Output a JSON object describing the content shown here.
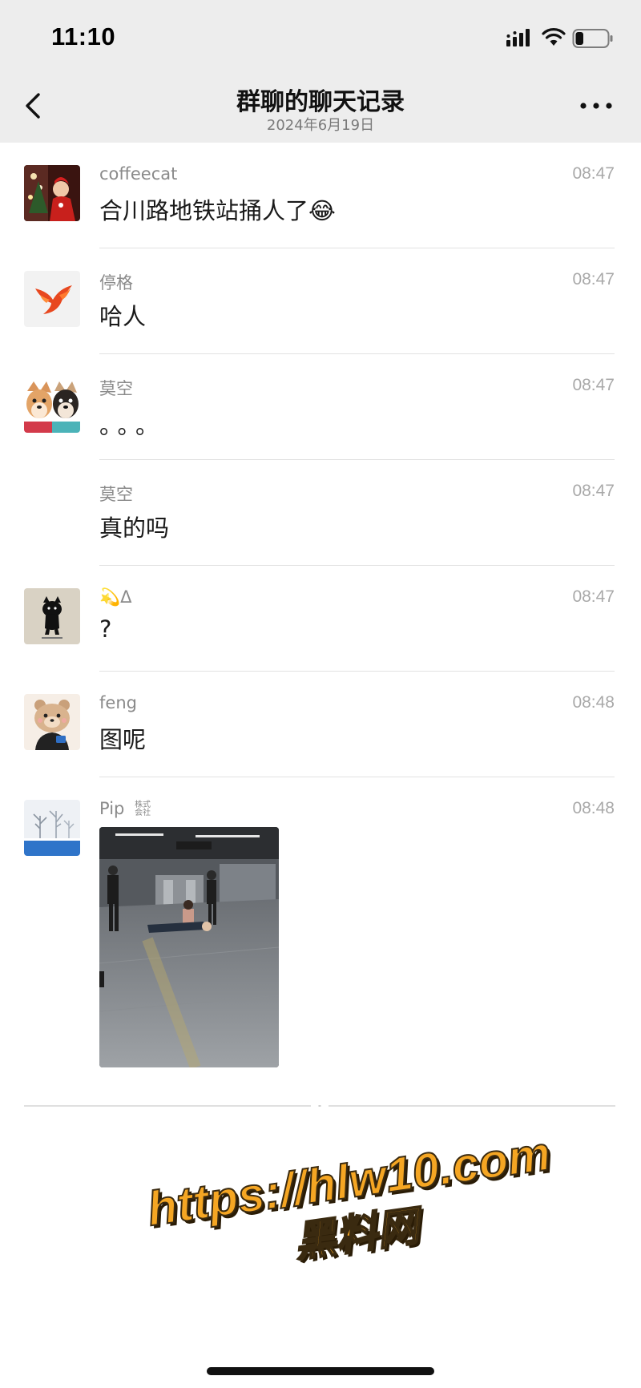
{
  "status_bar": {
    "time": "11:10",
    "signal_icon": "cellular-signal-icon",
    "wifi_icon": "wifi-icon",
    "battery_icon": "battery-icon",
    "battery_level": 0.25
  },
  "nav": {
    "back_icon": "chevron-left-icon",
    "title": "群聊的聊天记录",
    "subtitle": "2024年6月19日",
    "more_icon": "more-dots-icon"
  },
  "messages": [
    {
      "sender": "coffeecat",
      "time": "08:47",
      "text": "合川路地铁站捅人了😂",
      "avatar": "christmas-photo-avatar"
    },
    {
      "sender": "停格",
      "time": "08:47",
      "text": "哈人",
      "avatar": "red-phoenix-avatar"
    },
    {
      "sender": "莫空",
      "time": "08:47",
      "text": "。。。",
      "avatar": "shiba-dogs-avatar"
    },
    {
      "sender": "莫空",
      "time": "08:47",
      "text": "真的吗",
      "avatar": ""
    },
    {
      "sender": "💫ᐃ",
      "time": "08:47",
      "text": "?",
      "avatar": "black-cat-avatar"
    },
    {
      "sender": "feng",
      "time": "08:48",
      "text": "图呢",
      "avatar": "cartoon-bear-avatar"
    },
    {
      "sender": "Pip",
      "sender_badge": "株式\n会社",
      "time": "08:48",
      "text": "",
      "image": "subway-station-photo",
      "avatar": "winter-scene-avatar"
    }
  ],
  "watermark": {
    "url": "https://hlw10.com",
    "site": "黑料网"
  },
  "colors": {
    "header_bg": "#ededed",
    "watermark_fill": "#f5a623",
    "sender_gray": "#8a8a8a",
    "time_gray": "#a9a9a9"
  }
}
